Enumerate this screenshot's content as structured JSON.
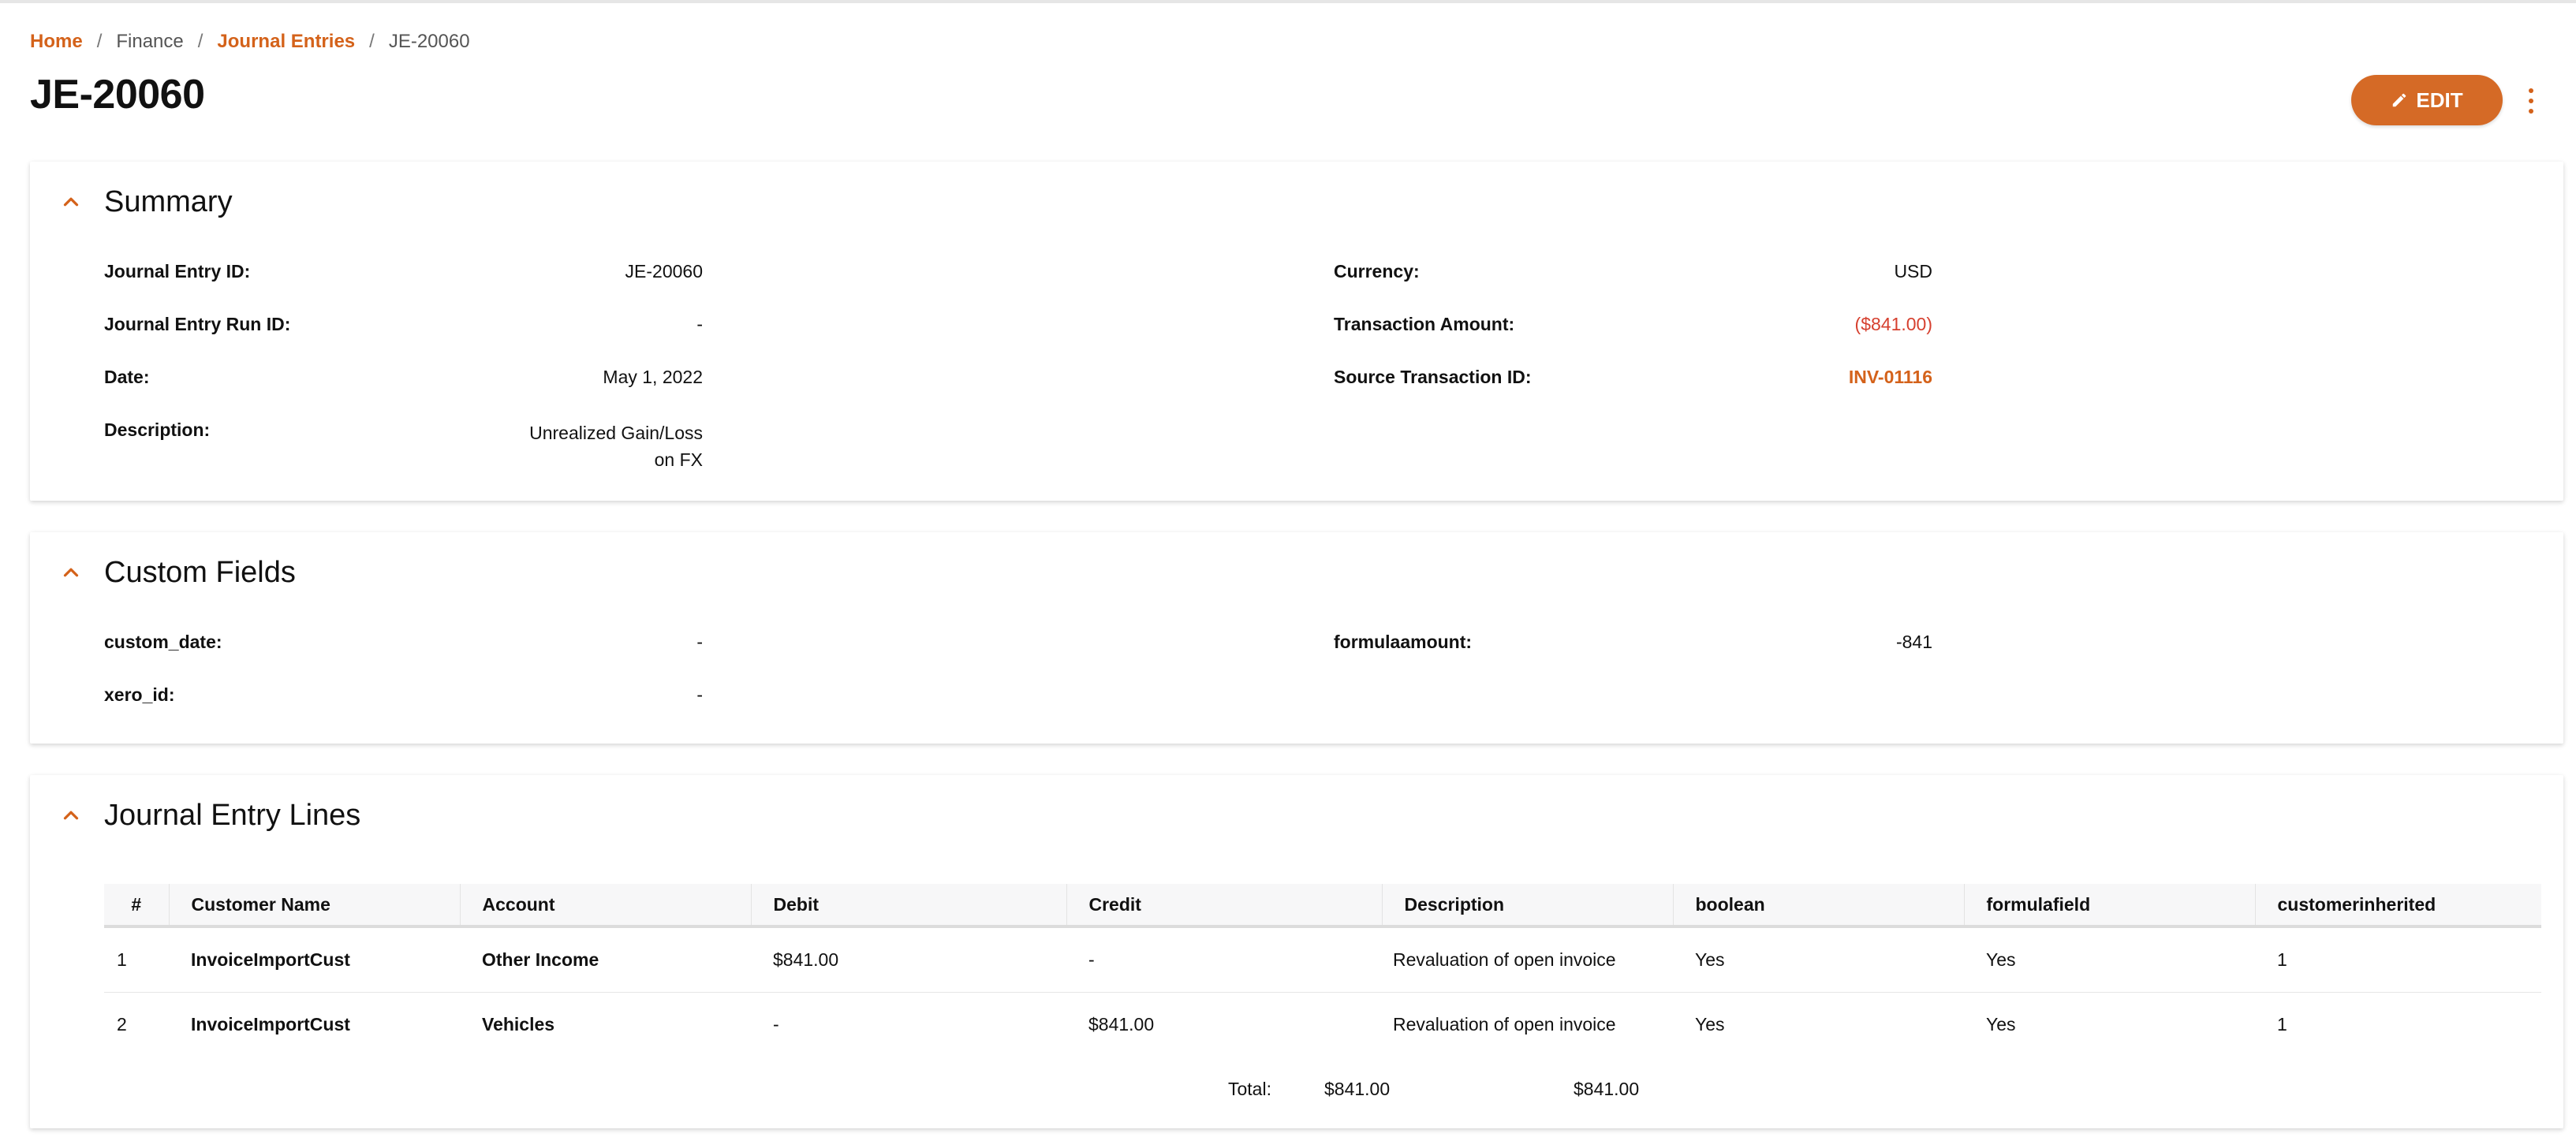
{
  "breadcrumb": {
    "home": "Home",
    "finance": "Finance",
    "journal_entries": "Journal Entries",
    "current": "JE-20060",
    "separator": "/"
  },
  "page": {
    "title": "JE-20060"
  },
  "actions": {
    "edit_label": "EDIT"
  },
  "summary": {
    "title": "Summary",
    "fields": {
      "journal_entry_id": {
        "label": "Journal Entry ID:",
        "value": "JE-20060"
      },
      "journal_entry_run_id": {
        "label": "Journal Entry Run ID:",
        "value": "-"
      },
      "date": {
        "label": "Date:",
        "value": "May 1, 2022"
      },
      "description": {
        "label": "Description:",
        "value_line1": "Unrealized Gain/Loss",
        "value_line2": "on FX"
      },
      "currency": {
        "label": "Currency:",
        "value": "USD"
      },
      "transaction_amount": {
        "label": "Transaction Amount:",
        "value": "($841.00)"
      },
      "source_transaction_id": {
        "label": "Source Transaction ID:",
        "value": "INV-01116"
      }
    }
  },
  "custom_fields": {
    "title": "Custom Fields",
    "fields": {
      "custom_date": {
        "label": "custom_date:",
        "value": "-"
      },
      "xero_id": {
        "label": "xero_id:",
        "value": "-"
      },
      "formulaamount": {
        "label": "formulaamount:",
        "value": "-841"
      }
    }
  },
  "lines": {
    "title": "Journal Entry Lines",
    "columns": [
      "#",
      "Customer Name",
      "Account",
      "Debit",
      "Credit",
      "Description",
      "boolean",
      "formulafield",
      "customerinherited"
    ],
    "rows": [
      {
        "num": "1",
        "customer": "InvoiceImportCust",
        "account": "Other Income",
        "debit": "$841.00",
        "credit": "-",
        "description": "Revaluation of open invoice",
        "boolean": "Yes",
        "formulafield": "Yes",
        "customerinherited": "1"
      },
      {
        "num": "2",
        "customer": "InvoiceImportCust",
        "account": "Vehicles",
        "debit": "-",
        "credit": "$841.00",
        "description": "Revaluation of open invoice",
        "boolean": "Yes",
        "formulafield": "Yes",
        "customerinherited": "1"
      }
    ],
    "totals": {
      "label": "Total:",
      "debit": "$841.00",
      "credit": "$841.00"
    }
  },
  "colors": {
    "accent": "#d56a26",
    "link": "#d4621a",
    "negative": "#d6402f"
  },
  "icons": {
    "edit": "pencil-icon",
    "more": "more-vertical-icon",
    "collapse": "chevron-up-icon"
  }
}
